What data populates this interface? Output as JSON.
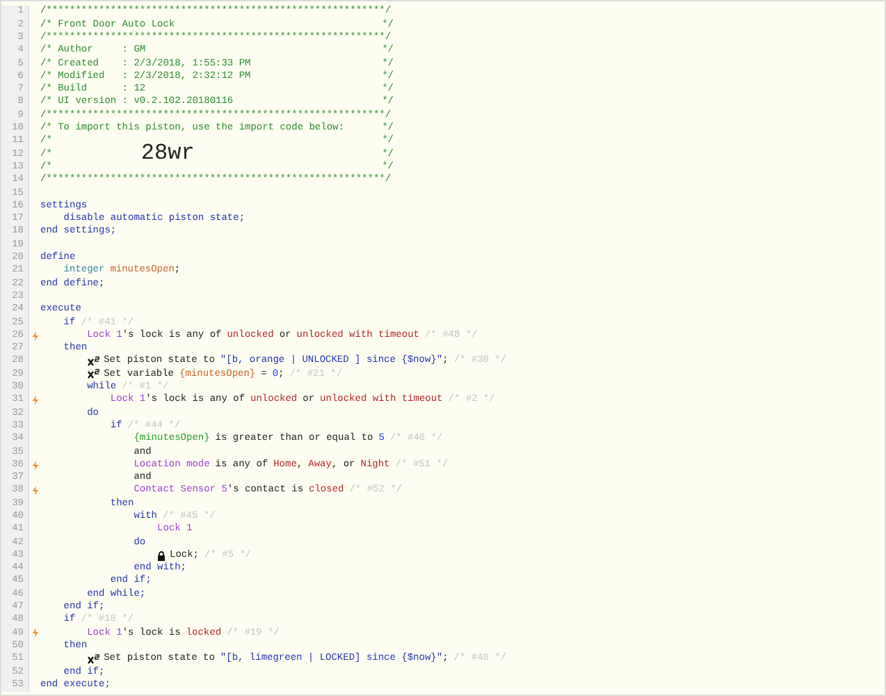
{
  "editor": {
    "lines": [
      {
        "number": "1",
        "flag": false,
        "tokens": [
          {
            "kind": "comment",
            "text": "/**********************************************************/"
          }
        ]
      },
      {
        "number": "2",
        "flag": false,
        "tokens": [
          {
            "kind": "comment",
            "text": "/* Front Door Auto Lock"
          },
          {
            "kind": "close",
            "text": "*/"
          }
        ]
      },
      {
        "number": "3",
        "flag": false,
        "tokens": [
          {
            "kind": "comment",
            "text": "/**********************************************************/"
          }
        ]
      },
      {
        "number": "4",
        "flag": false,
        "tokens": [
          {
            "kind": "comment",
            "text": "/* Author     : GM"
          },
          {
            "kind": "close",
            "text": "*/"
          }
        ]
      },
      {
        "number": "5",
        "flag": false,
        "tokens": [
          {
            "kind": "comment",
            "text": "/* Created    : 2/3/2018, 1:55:33 PM"
          },
          {
            "kind": "close",
            "text": "*/"
          }
        ]
      },
      {
        "number": "6",
        "flag": false,
        "tokens": [
          {
            "kind": "comment",
            "text": "/* Modified   : 2/3/2018, 2:32:12 PM"
          },
          {
            "kind": "close",
            "text": "*/"
          }
        ]
      },
      {
        "number": "7",
        "flag": false,
        "tokens": [
          {
            "kind": "comment",
            "text": "/* Build      : 12"
          },
          {
            "kind": "close",
            "text": "*/"
          }
        ]
      },
      {
        "number": "8",
        "flag": false,
        "tokens": [
          {
            "kind": "comment",
            "text": "/* UI version : v0.2.102.20180116"
          },
          {
            "kind": "close",
            "text": "*/"
          }
        ]
      },
      {
        "number": "9",
        "flag": false,
        "tokens": [
          {
            "kind": "comment",
            "text": "/**********************************************************/"
          }
        ]
      },
      {
        "number": "10",
        "flag": false,
        "tokens": [
          {
            "kind": "comment",
            "text": "/* To import this piston, use the import code below:"
          },
          {
            "kind": "close",
            "text": "*/"
          }
        ]
      },
      {
        "number": "11",
        "flag": false,
        "tokens": [
          {
            "kind": "comment",
            "text": "/*"
          },
          {
            "kind": "close",
            "text": "*/"
          }
        ]
      },
      {
        "number": "12",
        "flag": false,
        "tokens": [
          {
            "kind": "comment",
            "text": "/*"
          },
          {
            "kind": "big",
            "text": "28wr"
          },
          {
            "kind": "close",
            "text": "*/"
          }
        ]
      },
      {
        "number": "13",
        "flag": false,
        "tokens": [
          {
            "kind": "comment",
            "text": "/*"
          },
          {
            "kind": "close",
            "text": "*/"
          }
        ]
      },
      {
        "number": "14",
        "flag": false,
        "tokens": [
          {
            "kind": "comment",
            "text": "/**********************************************************/"
          }
        ]
      },
      {
        "number": "15",
        "flag": false
      },
      {
        "number": "16",
        "flag": false,
        "tokens": [
          {
            "kind": "keyword",
            "text": "settings"
          }
        ],
        "children": [
          {
            "number": "17",
            "flag": false,
            "tokens": [
              {
                "kind": "keyword",
                "text": "disable automatic piston state;"
              }
            ]
          }
        ]
      },
      {
        "number": "18",
        "flag": false,
        "tokens": [
          {
            "kind": "keyword",
            "text": "end settings;"
          }
        ]
      },
      {
        "number": "19",
        "flag": false
      },
      {
        "number": "20",
        "flag": false,
        "tokens": [
          {
            "kind": "keyword",
            "text": "define"
          }
        ],
        "children": [
          {
            "number": "21",
            "flag": false,
            "tokens": [
              {
                "kind": "type",
                "text": "integer"
              },
              {
                "kind": "variable",
                "text": "minutesOpen"
              },
              {
                "kind": "plain",
                "text": ";"
              }
            ]
          }
        ]
      },
      {
        "number": "22",
        "flag": false,
        "tokens": [
          {
            "kind": "keyword",
            "text": "end define;"
          }
        ]
      },
      {
        "number": "23",
        "flag": false
      },
      {
        "number": "24",
        "flag": false,
        "tokens": [
          {
            "kind": "keyword",
            "text": "execute"
          }
        ],
        "children": [
          {
            "number": "25",
            "flag": false,
            "tokens": [
              {
                "kind": "keyword",
                "text": "if"
              },
              {
                "kind": "hint",
                "text": "/* #41 */"
              }
            ],
            "children": [
              {
                "number": "26",
                "flag": true,
                "tokens": [
                  {
                    "kind": "device",
                    "text": "Lock 1"
                  },
                  {
                    "kind": "plain",
                    "text": "'s lock is any of"
                  },
                  {
                    "kind": "value",
                    "text": "unlocked"
                  },
                  {
                    "kind": "plain",
                    "text": "or"
                  },
                  {
                    "kind": "value",
                    "text": "unlocked with timeout"
                  },
                  {
                    "kind": "hint",
                    "text": "/* #48 */"
                  }
                ]
              }
            ]
          },
          {
            "number": "27",
            "flag": false,
            "tokens": [
              {
                "kind": "keyword",
                "text": "then"
              }
            ],
            "children": [
              {
                "number": "28",
                "flag": false,
                "kind": "set",
                "tokens": [
                  {
                    "kind": "plain",
                    "text": "Set piston state to"
                  },
                  {
                    "kind": "string",
                    "text": "\"[b, orange | UNLOCKED ] since {$now}\""
                  },
                  {
                    "kind": "plain",
                    "text": ";"
                  },
                  {
                    "kind": "hint",
                    "text": "/* #30 */"
                  }
                ]
              },
              {
                "number": "29",
                "flag": false,
                "kind": "set",
                "tokens": [
                  {
                    "kind": "plain",
                    "text": "Set variable"
                  },
                  {
                    "kind": "variable",
                    "text": "{minutesOpen}"
                  },
                  {
                    "kind": "plain",
                    "text": "="
                  },
                  {
                    "kind": "number",
                    "text": "0"
                  },
                  {
                    "kind": "plain",
                    "text": ";"
                  },
                  {
                    "kind": "hint",
                    "text": "/* #21 */"
                  }
                ]
              },
              {
                "number": "30",
                "flag": false,
                "tokens": [
                  {
                    "kind": "keyword",
                    "text": "while"
                  },
                  {
                    "kind": "hint",
                    "text": "/* #1 */"
                  }
                ],
                "children": [
                  {
                    "number": "31",
                    "flag": true,
                    "tokens": [
                      {
                        "kind": "device",
                        "text": "Lock 1"
                      },
                      {
                        "kind": "plain",
                        "text": "'s lock is any of"
                      },
                      {
                        "kind": "value",
                        "text": "unlocked"
                      },
                      {
                        "kind": "plain",
                        "text": "or"
                      },
                      {
                        "kind": "value",
                        "text": "unlocked with timeout"
                      },
                      {
                        "kind": "hint",
                        "text": "/* #2 */"
                      }
                    ]
                  }
                ]
              },
              {
                "number": "32",
                "flag": false,
                "tokens": [
                  {
                    "kind": "keyword",
                    "text": "do"
                  }
                ],
                "children": [
                  {
                    "number": "33",
                    "flag": false,
                    "tokens": [
                      {
                        "kind": "keyword",
                        "text": "if"
                      },
                      {
                        "kind": "hint",
                        "text": "/* #44 */"
                      }
                    ],
                    "children": [
                      {
                        "number": "34",
                        "flag": false,
                        "tokens": [
                          {
                            "kind": "expression",
                            "text": "{minutesOpen}"
                          },
                          {
                            "kind": "plain",
                            "text": "is greater than or equal to"
                          },
                          {
                            "kind": "number",
                            "text": "5"
                          },
                          {
                            "kind": "hint",
                            "text": "/* #46 */"
                          }
                        ]
                      },
                      {
                        "number": "35",
                        "flag": false,
                        "tokens": [
                          {
                            "kind": "plain",
                            "text": "and"
                          }
                        ]
                      },
                      {
                        "number": "36",
                        "flag": true,
                        "tokens": [
                          {
                            "kind": "device",
                            "text": "Location mode"
                          },
                          {
                            "kind": "plain",
                            "text": "is any of"
                          },
                          {
                            "kind": "value",
                            "text": "Home"
                          },
                          {
                            "kind": "plain",
                            "text": ","
                          },
                          {
                            "kind": "value",
                            "text": "Away"
                          },
                          {
                            "kind": "plain",
                            "text": ", or"
                          },
                          {
                            "kind": "value",
                            "text": "Night"
                          },
                          {
                            "kind": "hint",
                            "text": "/* #51 */"
                          }
                        ]
                      },
                      {
                        "number": "37",
                        "flag": false,
                        "tokens": [
                          {
                            "kind": "plain",
                            "text": "and"
                          }
                        ]
                      },
                      {
                        "number": "38",
                        "flag": true,
                        "tokens": [
                          {
                            "kind": "device",
                            "text": "Contact Sensor 5"
                          },
                          {
                            "kind": "plain",
                            "text": "'s contact is"
                          },
                          {
                            "kind": "value",
                            "text": "closed"
                          },
                          {
                            "kind": "hint",
                            "text": "/* #52 */"
                          }
                        ]
                      }
                    ]
                  },
                  {
                    "number": "39",
                    "flag": false,
                    "tokens": [
                      {
                        "kind": "keyword",
                        "text": "then"
                      }
                    ],
                    "children": [
                      {
                        "number": "40",
                        "flag": false,
                        "tokens": [
                          {
                            "kind": "keyword",
                            "text": "with"
                          },
                          {
                            "kind": "hint",
                            "text": "/* #45 */"
                          }
                        ],
                        "children": [
                          {
                            "number": "41",
                            "flag": false,
                            "tokens": [
                              {
                                "kind": "device",
                                "text": "Lock 1"
                              }
                            ]
                          }
                        ]
                      },
                      {
                        "number": "42",
                        "flag": false,
                        "tokens": [
                          {
                            "kind": "keyword",
                            "text": "do"
                          }
                        ],
                        "children": [
                          {
                            "number": "43",
                            "flag": false,
                            "kind": "command",
                            "tokens": [
                              {
                                "kind": "plain",
                                "text": "Lock;"
                              },
                              {
                                "kind": "hint",
                                "text": "/* #5 */"
                              }
                            ]
                          }
                        ]
                      },
                      {
                        "number": "44",
                        "flag": false,
                        "tokens": [
                          {
                            "kind": "keyword",
                            "text": "end with;"
                          }
                        ]
                      }
                    ]
                  },
                  {
                    "number": "45",
                    "flag": false,
                    "tokens": [
                      {
                        "kind": "keyword",
                        "text": "end if;"
                      }
                    ]
                  }
                ]
              },
              {
                "number": "46",
                "flag": false,
                "tokens": [
                  {
                    "kind": "keyword",
                    "text": "end while;"
                  }
                ]
              }
            ]
          },
          {
            "number": "47",
            "flag": false,
            "tokens": [
              {
                "kind": "keyword",
                "text": "end if;"
              }
            ]
          },
          {
            "number": "48",
            "flag": false,
            "tokens": [
              {
                "kind": "keyword",
                "text": "if"
              },
              {
                "kind": "hint",
                "text": "/* #18 */"
              }
            ],
            "children": [
              {
                "number": "49",
                "flag": true,
                "tokens": [
                  {
                    "kind": "device",
                    "text": "Lock 1"
                  },
                  {
                    "kind": "plain",
                    "text": "'s lock is"
                  },
                  {
                    "kind": "value",
                    "text": "locked"
                  },
                  {
                    "kind": "hint",
                    "text": "/* #19 */"
                  }
                ]
              }
            ]
          },
          {
            "number": "50",
            "flag": false,
            "tokens": [
              {
                "kind": "keyword",
                "text": "then"
              }
            ],
            "children": [
              {
                "number": "51",
                "flag": false,
                "kind": "set",
                "tokens": [
                  {
                    "kind": "plain",
                    "text": "Set piston state to"
                  },
                  {
                    "kind": "string",
                    "text": "\"[b, limegreen | LOCKED] since {$now}\""
                  },
                  {
                    "kind": "plain",
                    "text": ";"
                  },
                  {
                    "kind": "hint",
                    "text": "/* #40 */"
                  }
                ]
              }
            ]
          },
          {
            "number": "52",
            "flag": false,
            "tokens": [
              {
                "kind": "keyword",
                "text": "end if;"
              }
            ]
          }
        ]
      },
      {
        "number": "53",
        "flag": false,
        "tokens": [
          {
            "kind": "keyword",
            "text": "end execute;"
          }
        ]
      }
    ]
  }
}
